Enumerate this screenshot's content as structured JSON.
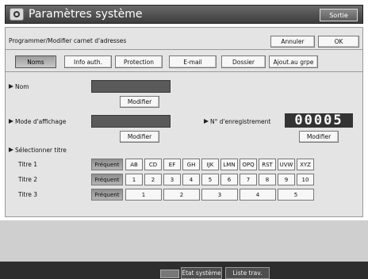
{
  "header": {
    "title": "Paramètres système",
    "exit_label": "Sortie"
  },
  "panel": {
    "headline": "Programmer/Modifier carnet d'adresses",
    "cancel_label": "Annuler",
    "ok_label": "OK",
    "tabs": [
      {
        "label": "Noms",
        "selected": true
      },
      {
        "label": "Info auth.",
        "selected": false
      },
      {
        "label": "Protection",
        "selected": false
      },
      {
        "label": "E-mail",
        "selected": false
      },
      {
        "label": "Dossier",
        "selected": false
      },
      {
        "label": "Ajout.au grpe",
        "selected": false
      }
    ]
  },
  "form": {
    "name_label": "Nom",
    "name_modify": "Modifier",
    "display_mode_label": "Mode d'affichage",
    "display_modify": "Modifier",
    "reg_label": "N° d'enregistrement",
    "reg_number": "00005",
    "reg_modify": "Modifier",
    "select_title_label": "Sélectionner titre"
  },
  "titles": [
    {
      "label": "Titre 1",
      "frequent": "Fréquent",
      "cells": [
        "AB",
        "CD",
        "EF",
        "GH",
        "IJK",
        "LMN",
        "OPQ",
        "RST",
        "UVW",
        "XYZ"
      ]
    },
    {
      "label": "Titre 2",
      "frequent": "Fréquent",
      "cells": [
        "1",
        "2",
        "3",
        "4",
        "5",
        "6",
        "7",
        "8",
        "9",
        "10"
      ]
    },
    {
      "label": "Titre 3",
      "frequent": "Fréquent",
      "cells": [
        "1",
        "2",
        "3",
        "4",
        "5"
      ]
    }
  ],
  "status": {
    "system_state": "État système",
    "job_list": "Liste trav."
  }
}
